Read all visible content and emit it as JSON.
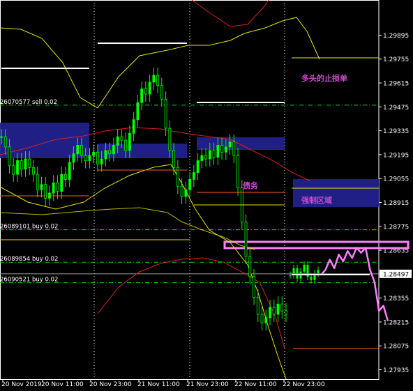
{
  "chart_data": {
    "type": "line",
    "title": "",
    "xlabel": "",
    "ylabel": "",
    "ylim": [
      1.2788,
      1.30101
    ],
    "grid": "vertical-dotted",
    "x_tick_labels": [
      "20 Nov 2019",
      "20 Nov 11:00",
      "20 Nov 23:00",
      "21 Nov 11:00",
      "21 Nov 23:00",
      "22 Nov 11:00",
      "22 Nov 23:00"
    ],
    "y_tick_labels": [
      "1.29895",
      "1.29755",
      "1.29615",
      "1.29475",
      "1.29335",
      "1.29195",
      "1.29055",
      "1.28915",
      "1.28775",
      "1.28635",
      "1.28497",
      "1.28355",
      "1.28215",
      "1.28075",
      "1.27935"
    ],
    "current_price": "1.28497",
    "order_lines": [
      {
        "label": "26070577 sell 0.02",
        "price": 1.29485
      },
      {
        "label": "26089101 buy 0.02",
        "price": 1.28755
      },
      {
        "label": "26089854 buy 0.02",
        "price": 1.28565
      },
      {
        "label": "26090521 buy 0.02",
        "price": 1.28445
      }
    ],
    "annotations": [
      {
        "text": "多头的止损单",
        "price": 1.2963
      },
      {
        "text": "债务",
        "price": 1.28965
      },
      {
        "text": "强制区域",
        "price": 1.28865
      }
    ],
    "colors": {
      "candles": "#00ff00",
      "upper_band": "#e6e600",
      "moving_average": "#dc1e1e",
      "zone_fill": "#21218c",
      "projection": "#ff7fff",
      "order_line": "#00dc00",
      "high_marker": "#ffffff",
      "low_marker": "#ff5a1e"
    },
    "price_path": [
      1.293,
      1.2924,
      1.2913,
      1.2908,
      1.2916,
      1.2911,
      1.2917,
      1.2912,
      1.2908,
      1.2899,
      1.2902,
      1.2894,
      1.2897,
      1.2903,
      1.2898,
      1.2908,
      1.2905,
      1.2915,
      1.292,
      1.2925,
      1.2919,
      1.2916,
      1.2919,
      1.2921,
      1.2914,
      1.2917,
      1.2922,
      1.292,
      1.2925,
      1.293,
      1.2928,
      1.2922,
      1.2932,
      1.294,
      1.295,
      1.2958,
      1.2955,
      1.2962,
      1.2966,
      1.296,
      1.2952,
      1.2935,
      1.2922,
      1.2912,
      1.2901,
      1.2895,
      1.2899,
      1.2905,
      1.2909,
      1.2916,
      1.2919,
      1.2917,
      1.2922,
      1.2918,
      1.2925,
      1.2921,
      1.2924,
      1.2927,
      1.2919,
      1.29,
      1.288,
      1.286,
      1.2848,
      1.2836,
      1.2826,
      1.2821,
      1.2824,
      1.283,
      1.2826,
      1.2832,
      1.2828,
      1.2826
    ],
    "projection_path": [
      1.2849,
      1.2852,
      1.2858,
      1.2853,
      1.2861,
      1.2857,
      1.2863,
      1.2859,
      1.2865,
      1.2862,
      1.2865,
      1.2852,
      1.2845,
      1.2828,
      1.2831,
      1.2822
    ],
    "recent_path": [
      1.2849,
      1.2853,
      1.2847,
      1.2851,
      1.2855,
      1.2848,
      1.2846,
      1.285,
      1.2852
    ]
  }
}
